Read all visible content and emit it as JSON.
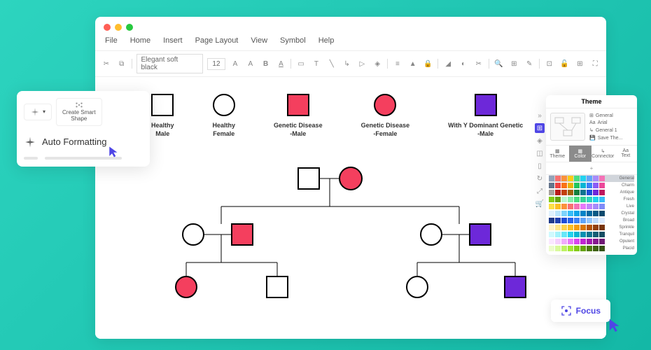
{
  "menu": {
    "file": "File",
    "home": "Home",
    "insert": "Insert",
    "page_layout": "Page Layout",
    "view": "View",
    "symbol": "Symbol",
    "help": "Help"
  },
  "toolbar": {
    "font": "Elegant soft black",
    "size": "12"
  },
  "legend": {
    "healthy_male": "Healthy\nMale",
    "healthy_female": "Healthy\nFemale",
    "genetic_male": "Genetic Disease\n-Male",
    "genetic_female": "Genetic Disease\n-Female",
    "y_dominant": "With Y Dominant Genetic\n-Male"
  },
  "floating": {
    "create_smart": "Create Smart\nShape",
    "auto_formatting": "Auto Formatting"
  },
  "theme": {
    "title": "Theme",
    "side_list": {
      "general": "General",
      "arial": "Arial",
      "general1": "General 1",
      "save": "Save The..."
    },
    "tabs": {
      "theme": "Theme",
      "color": "Color",
      "connector": "Connector",
      "text": "Text"
    },
    "palettes": [
      "General",
      "Charm",
      "Antique",
      "Fresh",
      "Live",
      "Crystal",
      "Broad",
      "Sprinkle",
      "Tranquil",
      "Opulent",
      "Placid"
    ]
  },
  "focus": {
    "label": "Focus"
  },
  "colors": {
    "red": "#f43f5e",
    "purple": "#6d28d9",
    "palette_rows": [
      [
        "#94a3b8",
        "#f87171",
        "#fb923c",
        "#facc15",
        "#4ade80",
        "#22d3ee",
        "#60a5fa",
        "#a78bfa",
        "#f472b6"
      ],
      [
        "#64748b",
        "#ef4444",
        "#f97316",
        "#eab308",
        "#22c55e",
        "#06b6d4",
        "#3b82f6",
        "#8b5cf6",
        "#ec4899"
      ],
      [
        "#a8a29e",
        "#b91c1c",
        "#c2410c",
        "#a16207",
        "#15803d",
        "#0e7490",
        "#1d4ed8",
        "#6d28d9",
        "#be185d"
      ],
      [
        "#84cc16",
        "#65a30d",
        "#bbf7d0",
        "#86efac",
        "#4ade80",
        "#34d399",
        "#2dd4bf",
        "#22d3ee",
        "#38bdf8"
      ],
      [
        "#fde047",
        "#fbbf24",
        "#fb923c",
        "#f87171",
        "#f472b6",
        "#e879f9",
        "#c084fc",
        "#a78bfa",
        "#818cf8"
      ],
      [
        "#e0f2fe",
        "#bae6fd",
        "#7dd3fc",
        "#38bdf8",
        "#0ea5e9",
        "#0284c7",
        "#0369a1",
        "#075985",
        "#0c4a6e"
      ],
      [
        "#1e3a8a",
        "#1e40af",
        "#1d4ed8",
        "#2563eb",
        "#3b82f6",
        "#60a5fa",
        "#93c5fd",
        "#bfdbfe",
        "#dbeafe"
      ],
      [
        "#fef3c7",
        "#fde68a",
        "#fcd34d",
        "#fbbf24",
        "#f59e0b",
        "#d97706",
        "#b45309",
        "#92400e",
        "#78350f"
      ],
      [
        "#cffafe",
        "#a5f3fc",
        "#67e8f9",
        "#22d3ee",
        "#06b6d4",
        "#0891b2",
        "#0e7490",
        "#155e75",
        "#164e63"
      ],
      [
        "#fae8ff",
        "#f5d0fe",
        "#f0abfc",
        "#e879f9",
        "#d946ef",
        "#c026d3",
        "#a21caf",
        "#86198f",
        "#701a75"
      ],
      [
        "#ecfccb",
        "#d9f99d",
        "#bef264",
        "#a3e635",
        "#84cc16",
        "#65a30d",
        "#4d7c0f",
        "#3f6212",
        "#365314"
      ]
    ]
  }
}
